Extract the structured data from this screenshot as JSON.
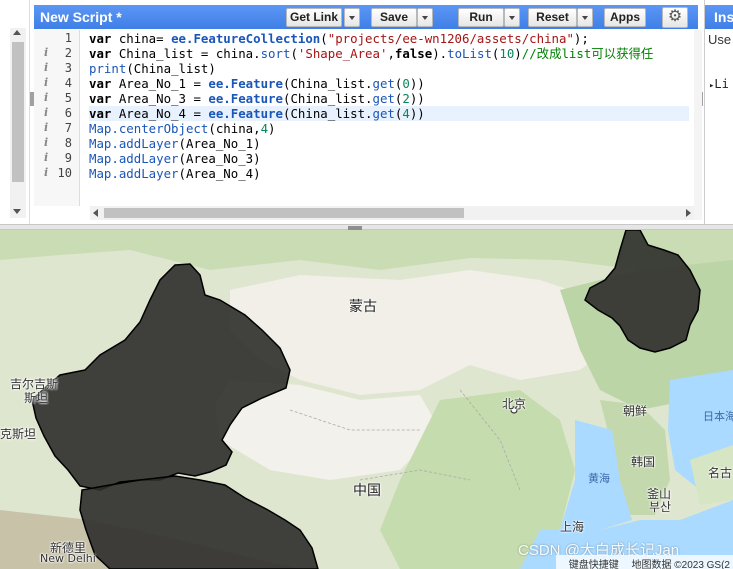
{
  "toolbar": {
    "title": "New Script *",
    "get_link": "Get Link",
    "save": "Save",
    "run": "Run",
    "reset": "Reset",
    "apps": "Apps",
    "settings_icon": "gear-icon"
  },
  "code": {
    "current_line": 6,
    "lines": [
      {
        "num": "1",
        "has_info": false,
        "segments": [
          {
            "t": "var ",
            "c": "kw"
          },
          {
            "t": "china= ",
            "c": ""
          },
          {
            "t": "ee.FeatureCollection",
            "c": "fn kw"
          },
          {
            "t": "(",
            "c": ""
          },
          {
            "t": "\"projects/ee-wn1206/assets/china\"",
            "c": "str"
          },
          {
            "t": ");",
            "c": ""
          }
        ]
      },
      {
        "num": "2",
        "has_info": true,
        "segments": [
          {
            "t": "var ",
            "c": "kw"
          },
          {
            "t": "China_list = china.",
            "c": ""
          },
          {
            "t": "sort",
            "c": "fn"
          },
          {
            "t": "(",
            "c": ""
          },
          {
            "t": "'Shape_Area'",
            "c": "str"
          },
          {
            "t": ",",
            "c": ""
          },
          {
            "t": "false",
            "c": "kw"
          },
          {
            "t": ").",
            "c": ""
          },
          {
            "t": "toList",
            "c": "fn"
          },
          {
            "t": "(",
            "c": ""
          },
          {
            "t": "10",
            "c": "num"
          },
          {
            "t": ")",
            "c": ""
          },
          {
            "t": "//改成list可以获得任",
            "c": "cmt"
          }
        ]
      },
      {
        "num": "3",
        "has_info": true,
        "segments": [
          {
            "t": "print",
            "c": "fn"
          },
          {
            "t": "(China_list)",
            "c": ""
          }
        ]
      },
      {
        "num": "4",
        "has_info": true,
        "segments": [
          {
            "t": "var ",
            "c": "kw"
          },
          {
            "t": "Area_No_1 = ",
            "c": ""
          },
          {
            "t": "ee.Feature",
            "c": "fn kw"
          },
          {
            "t": "(China_list.",
            "c": ""
          },
          {
            "t": "get",
            "c": "fn"
          },
          {
            "t": "(",
            "c": ""
          },
          {
            "t": "0",
            "c": "num"
          },
          {
            "t": "))",
            "c": ""
          }
        ]
      },
      {
        "num": "5",
        "has_info": true,
        "segments": [
          {
            "t": "var ",
            "c": "kw"
          },
          {
            "t": "Area_No_3 = ",
            "c": ""
          },
          {
            "t": "ee.Feature",
            "c": "fn kw"
          },
          {
            "t": "(China_list.",
            "c": ""
          },
          {
            "t": "get",
            "c": "fn"
          },
          {
            "t": "(",
            "c": ""
          },
          {
            "t": "2",
            "c": "num"
          },
          {
            "t": "))",
            "c": ""
          }
        ]
      },
      {
        "num": "6",
        "has_info": true,
        "segments": [
          {
            "t": "var ",
            "c": "kw"
          },
          {
            "t": "Area_No_4 = ",
            "c": ""
          },
          {
            "t": "ee.Feature",
            "c": "fn kw"
          },
          {
            "t": "(China_list.",
            "c": ""
          },
          {
            "t": "get",
            "c": "fn"
          },
          {
            "t": "(",
            "c": ""
          },
          {
            "t": "4",
            "c": "num"
          },
          {
            "t": "))",
            "c": ""
          }
        ]
      },
      {
        "num": "7",
        "has_info": true,
        "segments": [
          {
            "t": "Map.centerObject",
            "c": "fn"
          },
          {
            "t": "(china,",
            "c": ""
          },
          {
            "t": "4",
            "c": "num"
          },
          {
            "t": ")",
            "c": ""
          }
        ]
      },
      {
        "num": "8",
        "has_info": true,
        "segments": [
          {
            "t": "Map.addLayer",
            "c": "fn"
          },
          {
            "t": "(Area_No_1)",
            "c": ""
          }
        ]
      },
      {
        "num": "9",
        "has_info": true,
        "segments": [
          {
            "t": "Map.addLayer",
            "c": "fn"
          },
          {
            "t": "(Area_No_3)",
            "c": ""
          }
        ]
      },
      {
        "num": "10",
        "has_info": true,
        "segments": [
          {
            "t": "Map.addLayer",
            "c": "fn"
          },
          {
            "t": "(Area_No_4)",
            "c": ""
          }
        ]
      }
    ]
  },
  "right_panel": {
    "tab_title": "Ins",
    "use_text": "Use",
    "list_item": "Li"
  },
  "map": {
    "labels": {
      "mongolia": "蒙古",
      "kyrgyzstan_line1": "吉尔吉斯",
      "kyrgyzstan_line2": "斯坦",
      "tajik_partial": "克斯坦",
      "beijing": "北京",
      "north_korea": "朝鲜",
      "south_korea": "韩国",
      "china": "中国",
      "yellow_sea": "黄海",
      "shanghai": "上海",
      "busan_line1": "釜山",
      "busan_line2": "부산",
      "sea_of_japan": "日本海",
      "nagoya_partial": "名古",
      "new_delhi_line1": "新德里",
      "new_delhi_line2": "New Delhi"
    },
    "attribution_shortcuts": "键盘快捷键",
    "attribution_data": "地图数据 ©2023 GS(2",
    "watermark": "CSDN @大白成长记Jan",
    "colors": {
      "land": "#dfe6cf",
      "desert": "#f1efe8",
      "forest": "#b7d3a6",
      "water": "#aadaff",
      "feature_fill": "#2b2b2b"
    }
  }
}
